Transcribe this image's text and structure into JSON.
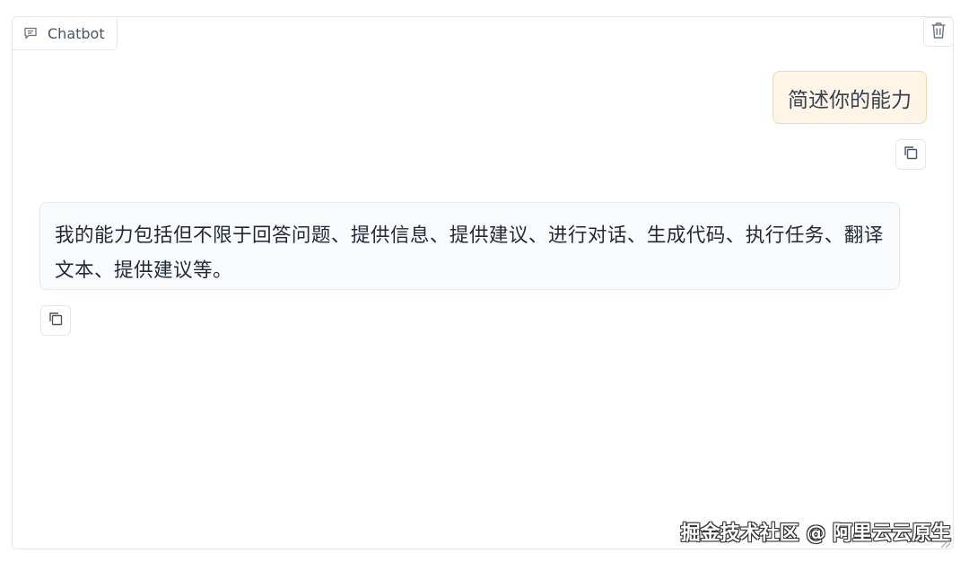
{
  "header": {
    "label": "Chatbot",
    "label_icon": "chat-bubble-icon",
    "clear_icon": "trash-icon"
  },
  "messages": [
    {
      "role": "user",
      "text": "简述你的能力",
      "copy_icon": "copy-icon"
    },
    {
      "role": "bot",
      "text": "我的能力包括但不限于回答问题、提供信息、提供建议、进行对话、生成代码、执行任务、翻译文本、提供建议等。",
      "copy_icon": "copy-icon"
    }
  ],
  "watermark": "掘金技术社区 @ 阿里云云原生",
  "colors": {
    "user_bubble_bg": "#fef5e7",
    "user_bubble_border": "#f5d8a3",
    "bot_bubble_bg": "#f9fafb",
    "border": "#e5e7eb"
  }
}
